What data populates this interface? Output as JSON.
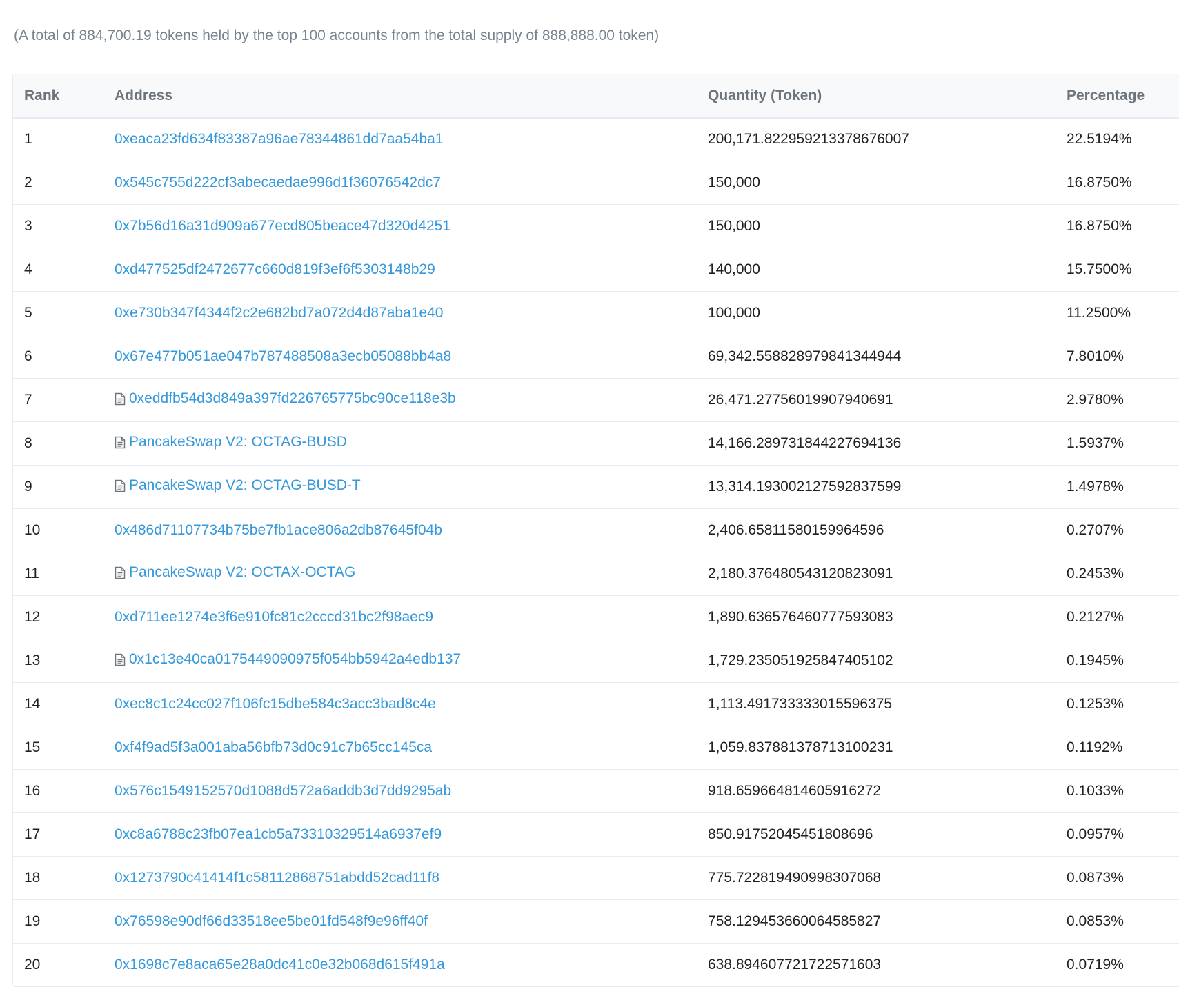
{
  "summary": "(A total of 884,700.19 tokens held by the top 100 accounts from the total supply of 888,888.00 token)",
  "table": {
    "headers": {
      "rank": "Rank",
      "address": "Address",
      "quantity": "Quantity (Token)",
      "percentage": "Percentage"
    },
    "rows": [
      {
        "rank": "1",
        "address": "0xeaca23fd634f83387a96ae78344861dd7aa54ba1",
        "contract": false,
        "quantity": "200,171.822959213378676007",
        "percentage": "22.5194%"
      },
      {
        "rank": "2",
        "address": "0x545c755d222cf3abecaedae996d1f36076542dc7",
        "contract": false,
        "quantity": "150,000",
        "percentage": "16.8750%"
      },
      {
        "rank": "3",
        "address": "0x7b56d16a31d909a677ecd805beace47d320d4251",
        "contract": false,
        "quantity": "150,000",
        "percentage": "16.8750%"
      },
      {
        "rank": "4",
        "address": "0xd477525df2472677c660d819f3ef6f5303148b29",
        "contract": false,
        "quantity": "140,000",
        "percentage": "15.7500%"
      },
      {
        "rank": "5",
        "address": "0xe730b347f4344f2c2e682bd7a072d4d87aba1e40",
        "contract": false,
        "quantity": "100,000",
        "percentage": "11.2500%"
      },
      {
        "rank": "6",
        "address": "0x67e477b051ae047b787488508a3ecb05088bb4a8",
        "contract": false,
        "quantity": "69,342.558828979841344944",
        "percentage": "7.8010%"
      },
      {
        "rank": "7",
        "address": "0xeddfb54d3d849a397fd226765775bc90ce118e3b",
        "contract": true,
        "quantity": "26,471.27756019907940691",
        "percentage": "2.9780%"
      },
      {
        "rank": "8",
        "address": "PancakeSwap V2: OCTAG-BUSD",
        "contract": true,
        "quantity": "14,166.289731844227694136",
        "percentage": "1.5937%"
      },
      {
        "rank": "9",
        "address": "PancakeSwap V2: OCTAG-BUSD-T",
        "contract": true,
        "quantity": "13,314.193002127592837599",
        "percentage": "1.4978%"
      },
      {
        "rank": "10",
        "address": "0x486d71107734b75be7fb1ace806a2db87645f04b",
        "contract": false,
        "quantity": "2,406.65811580159964596",
        "percentage": "0.2707%"
      },
      {
        "rank": "11",
        "address": "PancakeSwap V2: OCTAX-OCTAG",
        "contract": true,
        "quantity": "2,180.37648054312082309​1",
        "percentage": "0.2453%"
      },
      {
        "rank": "12",
        "address": "0xd711ee1274e3f6e910fc81c2cccd31bc2f98aec9",
        "contract": false,
        "quantity": "1,890.636576460777593083",
        "percentage": "0.2127%"
      },
      {
        "rank": "13",
        "address": "0x1c13e40ca0175449090975f054bb5942a4edb137",
        "contract": true,
        "quantity": "1,729.235051925847405102",
        "percentage": "0.1945%"
      },
      {
        "rank": "14",
        "address": "0xec8c1c24cc027f106fc15dbe584c3acc3bad8c4e",
        "contract": false,
        "quantity": "1,113.491733333015596375",
        "percentage": "0.1253%"
      },
      {
        "rank": "15",
        "address": "0xf4f9ad5f3a001aba56bfb73d0c91c7b65cc145ca",
        "contract": false,
        "quantity": "1,059.837881378713100231",
        "percentage": "0.1192%"
      },
      {
        "rank": "16",
        "address": "0x576c1549152570d1088d572a6addb3d7dd9295ab",
        "contract": false,
        "quantity": "918.659664814605916272",
        "percentage": "0.1033%"
      },
      {
        "rank": "17",
        "address": "0xc8a6788c23fb07ea1cb5a73310329514a6937ef9",
        "contract": false,
        "quantity": "850.91752045451808696",
        "percentage": "0.0957%"
      },
      {
        "rank": "18",
        "address": "0x1273790c41414f1c58112868751abdd52cad11f8",
        "contract": false,
        "quantity": "775.722819490998307068",
        "percentage": "0.0873%"
      },
      {
        "rank": "19",
        "address": "0x76598e90df66d33518ee5be01fd548f9e96ff40f",
        "contract": false,
        "quantity": "758.129453660064585827",
        "percentage": "0.0853%"
      },
      {
        "rank": "20",
        "address": "0x1698c7e8aca65e28a0dc41c0e32b068d615f491a",
        "contract": false,
        "quantity": "638.894607721722571603",
        "percentage": "0.0719%"
      }
    ]
  },
  "colors": {
    "link": "#3498db",
    "header_text": "#6c757d",
    "header_bg": "#f8f9fa",
    "muted_text": "#77838f",
    "row_border": "#e7eaf3"
  },
  "icons": {
    "contract": "file-document-icon"
  }
}
